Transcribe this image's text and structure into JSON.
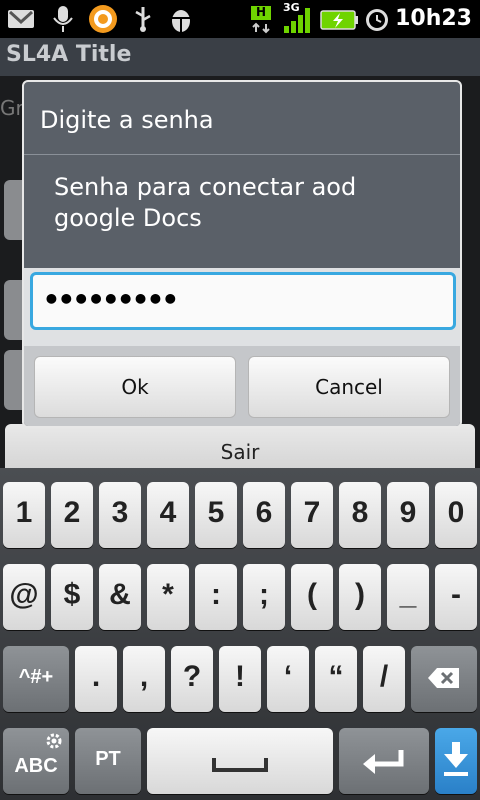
{
  "statusbar": {
    "time": "10h23",
    "network_label": "3G",
    "sync_label": "H",
    "icons": [
      "gmail-icon",
      "voice-mic-icon",
      "orange-app-icon",
      "usb-icon",
      "android-debug-icon",
      "signal-icon",
      "battery-icon",
      "alarm-icon"
    ]
  },
  "app": {
    "title": "SL4A Title",
    "background_text": "Gr",
    "exit_button": "Sair"
  },
  "dialog": {
    "title": "Digite a senha",
    "message": "Senha para conectar aod google Docs",
    "password_value": "•••••••••",
    "ok_label": "Ok",
    "cancel_label": "Cancel"
  },
  "keyboard": {
    "row1": [
      "1",
      "2",
      "3",
      "4",
      "5",
      "6",
      "7",
      "8",
      "9",
      "0"
    ],
    "row2": [
      "@",
      "$",
      "&",
      "*",
      ":",
      ";",
      "(",
      ")",
      "_",
      "-"
    ],
    "row3_left": "^#+",
    "row3": [
      ".",
      ",",
      "?",
      "!",
      "‘",
      "“",
      "/"
    ],
    "abc": "ABC",
    "language": "PT"
  },
  "colors": {
    "focus_border": "#39a8e0",
    "battery_fill": "#6fd400"
  }
}
